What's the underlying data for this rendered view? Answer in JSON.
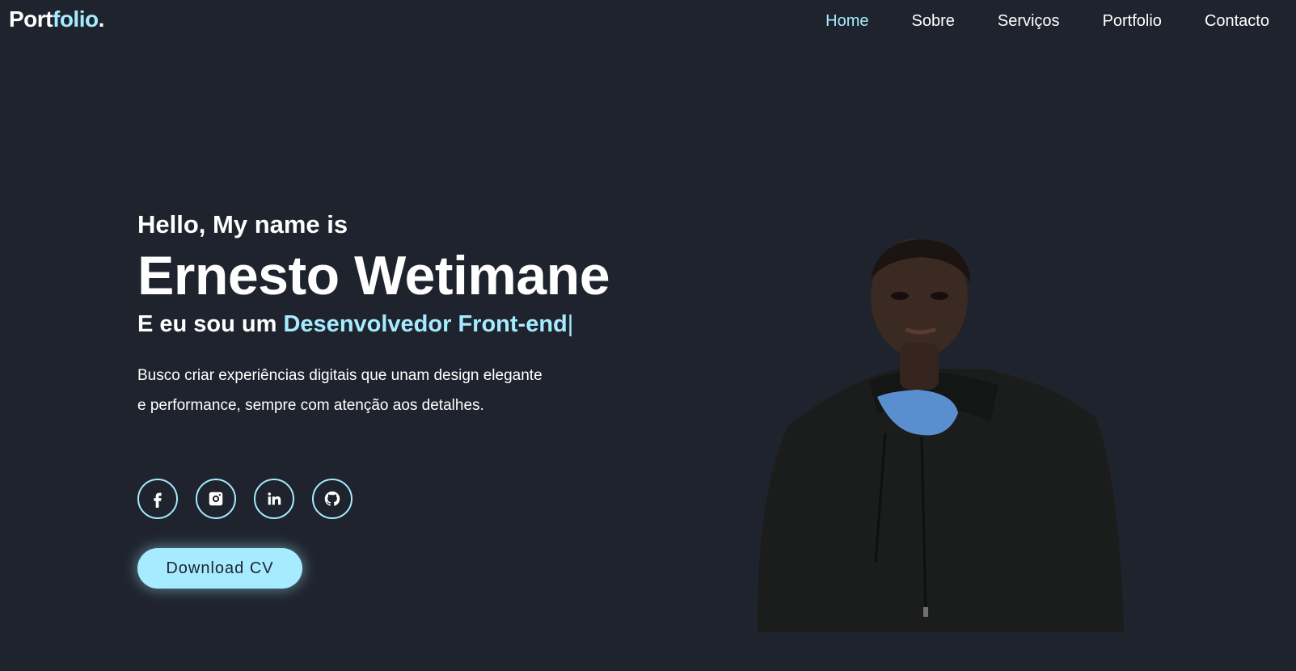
{
  "header": {
    "logo_main": "Port",
    "logo_accent": "folio",
    "logo_dot": ".",
    "nav": [
      {
        "label": "Home",
        "active": true
      },
      {
        "label": "Sobre",
        "active": false
      },
      {
        "label": "Serviços",
        "active": false
      },
      {
        "label": "Portfolio",
        "active": false
      },
      {
        "label": "Contacto",
        "active": false
      }
    ]
  },
  "hero": {
    "greeting": "Hello, My name is",
    "name": "Ernesto Wetimane",
    "role_prefix": "E eu sou um",
    "role_highlight": "Desenvolvedor Front-end",
    "cursor": "|",
    "description_line1": "Busco criar experiências digitais que unam design elegante",
    "description_line2": "e performance, sempre com atenção aos detalhes.",
    "socials": [
      "facebook-icon",
      "instagram-icon",
      "linkedin-icon",
      "github-icon"
    ],
    "cv_button": "Download CV"
  },
  "colors": {
    "background": "#1f232d",
    "accent": "#a6ebff",
    "text": "#ffffff"
  }
}
